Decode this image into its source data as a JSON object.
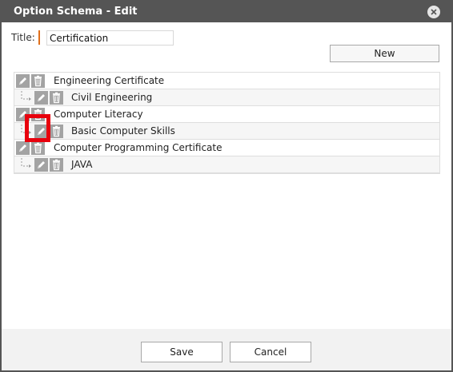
{
  "dialog": {
    "title": "Option Schema - Edit"
  },
  "form": {
    "title_label": "Title:",
    "title_value": "Certification",
    "new_label": "New"
  },
  "tree": [
    {
      "label": "Engineering Certificate",
      "level": 0
    },
    {
      "label": "Civil Engineering",
      "level": 1
    },
    {
      "label": "Computer Literacy",
      "level": 0
    },
    {
      "label": "Basic Computer Skills",
      "level": 1
    },
    {
      "label": "Computer Programming Certificate",
      "level": 0
    },
    {
      "label": "JAVA",
      "level": 1
    }
  ],
  "footer": {
    "save_label": "Save",
    "cancel_label": "Cancel"
  },
  "colors": {
    "titlebar": "#555555",
    "required_marker": "#e0701c",
    "highlight": "#e8000d",
    "icon_button": "#a3a3a3"
  }
}
